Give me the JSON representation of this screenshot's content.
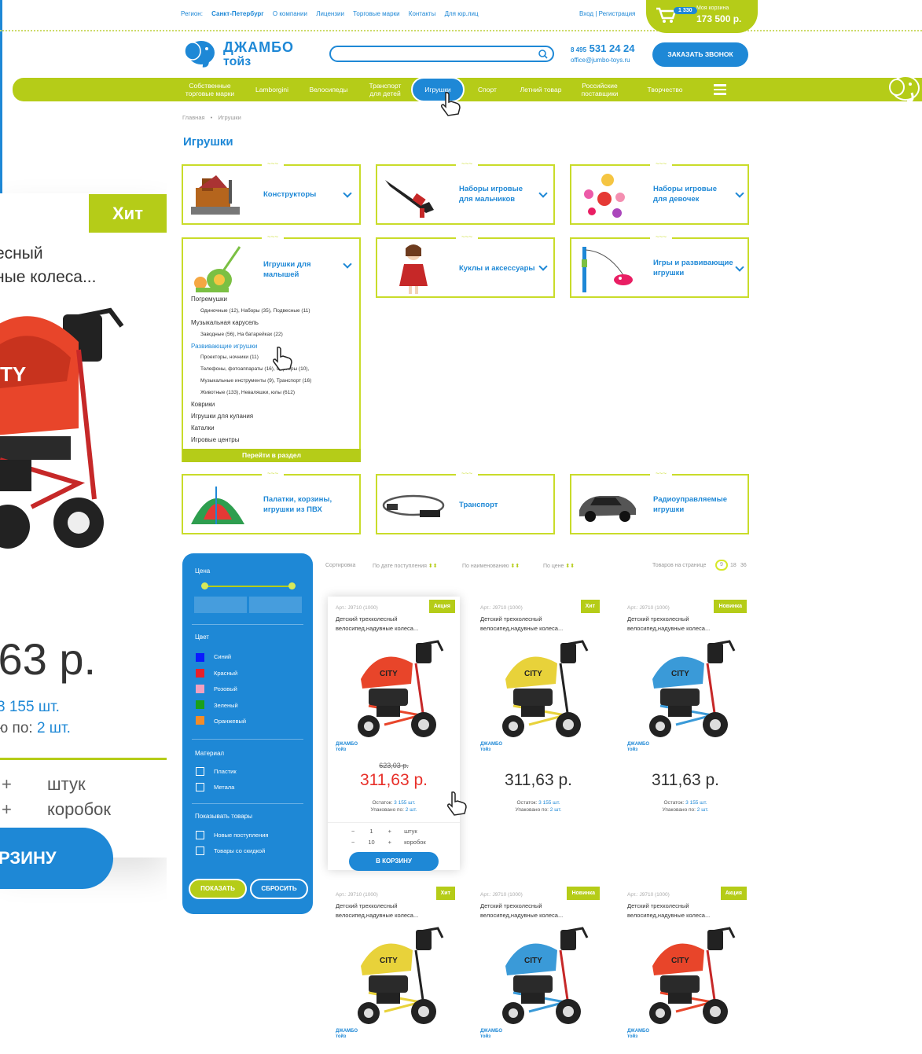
{
  "zoom": {
    "badge": "Хит",
    "title_line1": "есный",
    "title_line2": "ные колеса...",
    "price": ",63 р.",
    "stock_line1": "3 155 шт.",
    "stock_line2_prefix": "ю по: ",
    "stock_line2_value": "2 шт.",
    "qty_unit1": "штук",
    "qty_unit2": "коробок",
    "cart_button": "РЗИНУ"
  },
  "header": {
    "region_label": "Регион: ",
    "region_value": "Санкт-Петербург",
    "links": [
      "О компании",
      "Лицензии",
      "Торговые марки",
      "Контакты",
      "Для юр.лиц"
    ],
    "auth": "Вход | Регистрация",
    "cart": {
      "count": "1 330",
      "label": "Моя корзина",
      "total": "173 500 р."
    },
    "logo_line1": "ДЖАМБО",
    "logo_line2": "тойз",
    "phone_prefix": "8 495",
    "phone": "531 24 24",
    "email": "office@jumbo-toys.ru",
    "call_button": "ЗАКАЗАТЬ ЗВОНОК"
  },
  "nav": [
    "Собственные\nторговые марки",
    "Lamborgini",
    "Велосипеды",
    "Транспорт\nдля детей",
    "Игрушки",
    "Спорт",
    "Летний товар",
    "Российские\nпоставщики",
    "Творчество"
  ],
  "breadcrumbs": [
    "Главная",
    "Игрушки"
  ],
  "page_title": "Игрушки",
  "categories": [
    "Конструкторы",
    "Наборы игровые\nдля мальчиков",
    "Наборы игровые\nдля девочек",
    "Игрушки для\nмалышей",
    "Куклы и аксессуары",
    "Игры и развивающие\nигрушки",
    "Палатки, корзины,\nигрушки из ПВХ",
    "Транспорт",
    "Радиоуправляемые\nигрушки"
  ],
  "submenu": {
    "items": [
      {
        "text": "Погремушки",
        "level": 0
      },
      {
        "text": "Одиночные (12), Наборы (35), Подвесные (11)",
        "level": 1
      },
      {
        "text": "Музыкальная карусель",
        "level": 0
      },
      {
        "text": "Заводные (56), На батарейках (22)",
        "level": 1
      },
      {
        "text": "Развивающие игрушки",
        "level": 0,
        "link": true
      },
      {
        "text": "Проекторы, ночники (11)",
        "level": 1
      },
      {
        "text": "Телефоны, фотоаппараты (16), Сортеры (10),",
        "level": 1
      },
      {
        "text": "Музыкальные инструменты (9), Транспорт (16)",
        "level": 1
      },
      {
        "text": "Животные (133), Неваляшки, юлы (612)",
        "level": 1
      },
      {
        "text": "Коврики",
        "level": 0
      },
      {
        "text": "Игрушки для купания",
        "level": 0
      },
      {
        "text": "Каталки",
        "level": 0
      },
      {
        "text": "Игровые центры",
        "level": 0
      }
    ],
    "go_button": "Перейти в раздел"
  },
  "filter": {
    "price_label": "Цена",
    "color_label": "Цвет",
    "colors": [
      {
        "name": "Синий",
        "hex": "#0a1aff"
      },
      {
        "name": "Красный",
        "hex": "#e8202a"
      },
      {
        "name": "Розовый",
        "hex": "#f2a0c0"
      },
      {
        "name": "Зеленый",
        "hex": "#1aa01a"
      },
      {
        "name": "Оранжевый",
        "hex": "#f28c28"
      }
    ],
    "material_label": "Материал",
    "materials": [
      "Пластик",
      "Метала"
    ],
    "show_label": "Показывать товары",
    "show_options": [
      "Новые поступления",
      "Товары со скидкой"
    ],
    "apply_button": "ПОКАЗАТЬ",
    "reset_button": "СБРОСИТЬ"
  },
  "sort": {
    "label": "Сортировка",
    "options": [
      "По дате поступления",
      "По наименованию",
      "По цене"
    ],
    "per_page_label": "Товаров на странице",
    "per_page": [
      "9",
      "18",
      "36"
    ]
  },
  "products": [
    {
      "art": "Арт.: J9710 (1000)",
      "badge": "Акция",
      "name": "Детский трехколесный велосипед,надувные колеса...",
      "old_price": "623,03 р.",
      "price": "311,63 р.",
      "stock_label": "Остаток:",
      "stock": "3 155 шт.",
      "pack_label": "Упаковано по:",
      "pack": "2 шт.",
      "color": "#e8452a"
    },
    {
      "art": "Арт.: J9710 (1000)",
      "badge": "Хит",
      "name": "Детский трехколесный велосипед,надувные колеса...",
      "price": "311,63 р.",
      "stock_label": "Остаток:",
      "stock": "3 155 шт.",
      "pack_label": "Упаковано по:",
      "pack": "2 шт.",
      "color": "#e8d23a"
    },
    {
      "art": "Арт.: J9710 (1000)",
      "badge": "Новинка",
      "name": "Детский трехколесный велосипед,надувные колеса...",
      "price": "311,63 р.",
      "stock_label": "Остаток:",
      "stock": "3 155 шт.",
      "pack_label": "Упаковано по:",
      "pack": "2 шт.",
      "color": "#3a9ad8"
    },
    {
      "art": "Арт.: J9710 (1000)",
      "badge": "Хит",
      "name": "Детский трехколесный велосипед,надувные колеса...",
      "color": "#e8d23a"
    },
    {
      "art": "Арт.: J9710 (1000)",
      "badge": "Новинка",
      "name": "Детский трехколесный велосипед,надувные колеса...",
      "color": "#3a9ad8"
    },
    {
      "art": "Арт.: J9710 (1000)",
      "badge": "Акция",
      "name": "Детский трехколесный велосипед,надувные колеса...",
      "color": "#e8452a"
    }
  ],
  "hover_card": {
    "qty1": "1",
    "unit1": "штук",
    "qty2": "10",
    "unit2": "коробок",
    "cart_button": "В КОРЗИНУ"
  },
  "card_brand": [
    "ДЖАМБО",
    "тойз"
  ]
}
